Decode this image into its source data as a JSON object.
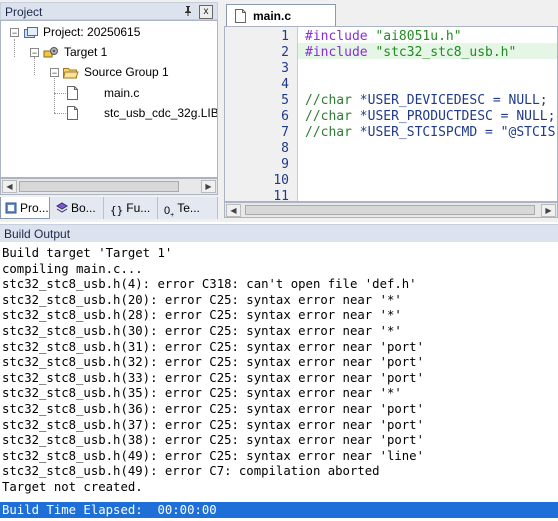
{
  "project_panel": {
    "title": "Project",
    "pin": "ᵖ",
    "close": "x",
    "tree": {
      "project": "Project: 20250615",
      "target": "Target 1",
      "group": "Source Group 1",
      "files": [
        "main.c",
        "stc_usb_cdc_32g.LIB"
      ]
    },
    "tabs": [
      "Pro...",
      "Bo...",
      "Fu...",
      "Te..."
    ],
    "tab_icons": [
      "book-icon",
      "books-icon",
      "braces-icon",
      "template-icon"
    ]
  },
  "editor": {
    "tab_label": "main.c",
    "lines": [
      {
        "n": "1",
        "parts": [
          [
            "kw",
            "#include "
          ],
          [
            "str",
            "\"ai8051u.h\""
          ]
        ]
      },
      {
        "n": "2",
        "parts": [
          [
            "kw",
            "#include "
          ],
          [
            "str",
            "\"stc32_stc8_usb.h\""
          ]
        ]
      },
      {
        "n": "3",
        "parts": []
      },
      {
        "n": "4",
        "parts": []
      },
      {
        "n": "5",
        "parts": [
          [
            "cmt",
            "//char "
          ],
          [
            "blu",
            "*USER_DEVICEDESC = NULL;"
          ]
        ]
      },
      {
        "n": "6",
        "parts": [
          [
            "cmt",
            "//char "
          ],
          [
            "blu",
            "*USER_PRODUCTDESC = NULL;"
          ]
        ]
      },
      {
        "n": "7",
        "parts": [
          [
            "cmt",
            "//char "
          ],
          [
            "blu",
            "*USER_STCISPCMD = \"@STCIS"
          ]
        ]
      },
      {
        "n": "8",
        "parts": []
      },
      {
        "n": "9",
        "parts": []
      },
      {
        "n": "10",
        "parts": []
      },
      {
        "n": "11",
        "parts": []
      }
    ]
  },
  "build_output": {
    "title": "Build Output",
    "lines": [
      "Build target 'Target 1'",
      "compiling main.c...",
      "stc32_stc8_usb.h(4): error C318: can't open file 'def.h'",
      "stc32_stc8_usb.h(20): error C25: syntax error near '*'",
      "stc32_stc8_usb.h(28): error C25: syntax error near '*'",
      "stc32_stc8_usb.h(30): error C25: syntax error near '*'",
      "stc32_stc8_usb.h(31): error C25: syntax error near 'port'",
      "stc32_stc8_usb.h(32): error C25: syntax error near 'port'",
      "stc32_stc8_usb.h(33): error C25: syntax error near 'port'",
      "stc32_stc8_usb.h(35): error C25: syntax error near '*'",
      "stc32_stc8_usb.h(36): error C25: syntax error near 'port'",
      "stc32_stc8_usb.h(37): error C25: syntax error near 'port'",
      "stc32_stc8_usb.h(38): error C25: syntax error near 'port'",
      "stc32_stc8_usb.h(49): error C25: syntax error near 'line'",
      "stc32_stc8_usb.h(49): error C7: compilation aborted",
      "Target not created."
    ],
    "status": "Build Time Elapsed:  00:00:00"
  },
  "colors": {
    "accent": "#1e6fd8",
    "keyword": "#8a2be2",
    "string": "#228b22",
    "comment": "#2e7d32",
    "line_number": "#1f3a8a"
  }
}
